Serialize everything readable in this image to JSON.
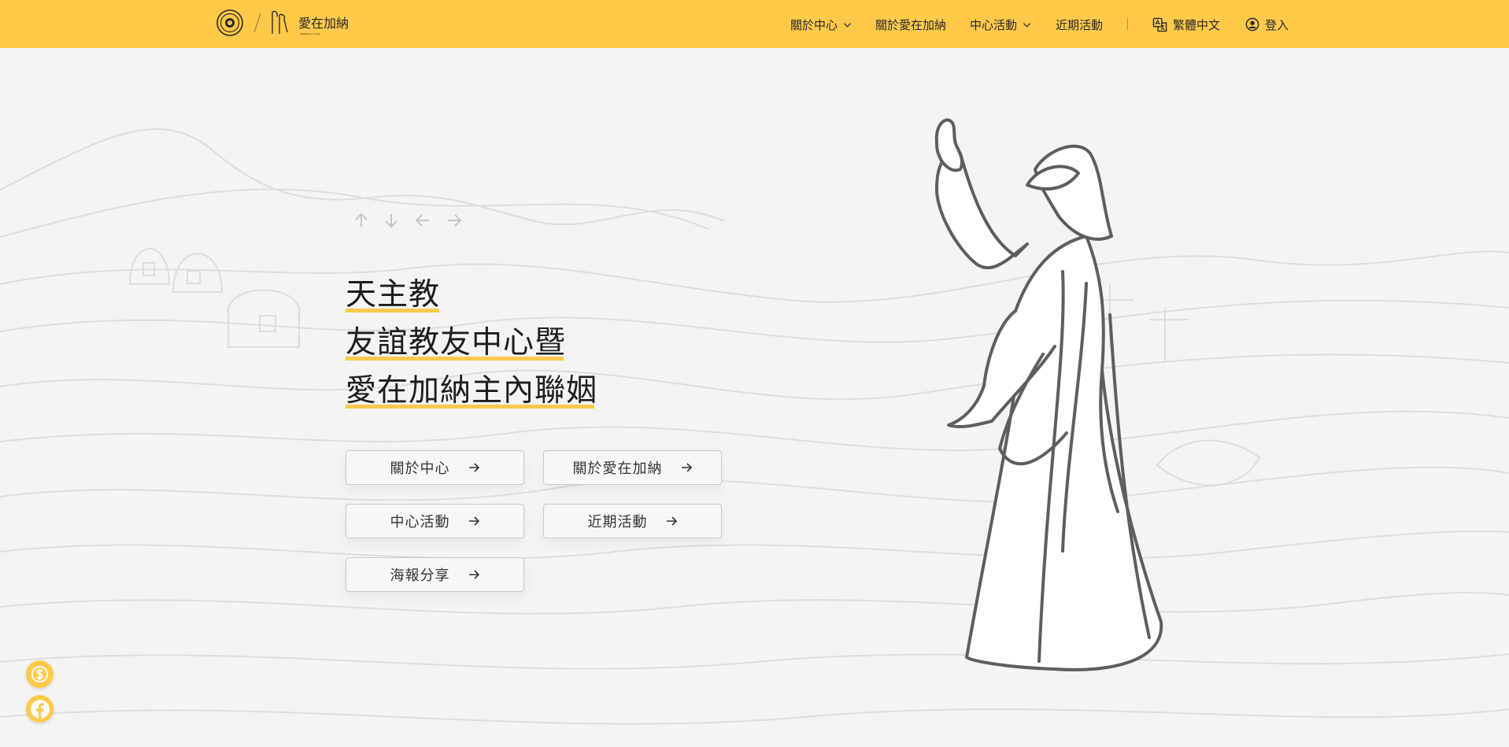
{
  "nav": {
    "items": [
      {
        "label": "關於中心",
        "has_dropdown": true
      },
      {
        "label": "關於愛在加納",
        "has_dropdown": false
      },
      {
        "label": "中心活動",
        "has_dropdown": true
      },
      {
        "label": "近期活動",
        "has_dropdown": false
      }
    ],
    "language": "繁體中文",
    "login": "登入"
  },
  "brand": {
    "logo_text": "愛在加納",
    "logo_subtext": "Wedding in Cana"
  },
  "hero": {
    "headline": [
      "天主教",
      "友誼教友中心暨",
      "愛在加納主內聯姻"
    ]
  },
  "buttons": [
    {
      "label": "關於中心"
    },
    {
      "label": "關於愛在加納"
    },
    {
      "label": "中心活動"
    },
    {
      "label": "近期活動"
    },
    {
      "label": "海報分享"
    }
  ],
  "floating": {
    "donate_icon": "dollar-icon",
    "facebook_icon": "facebook-icon"
  },
  "colors": {
    "accent": "#ffc94a",
    "background": "#f4f4f4",
    "text": "#1d1d1d"
  }
}
